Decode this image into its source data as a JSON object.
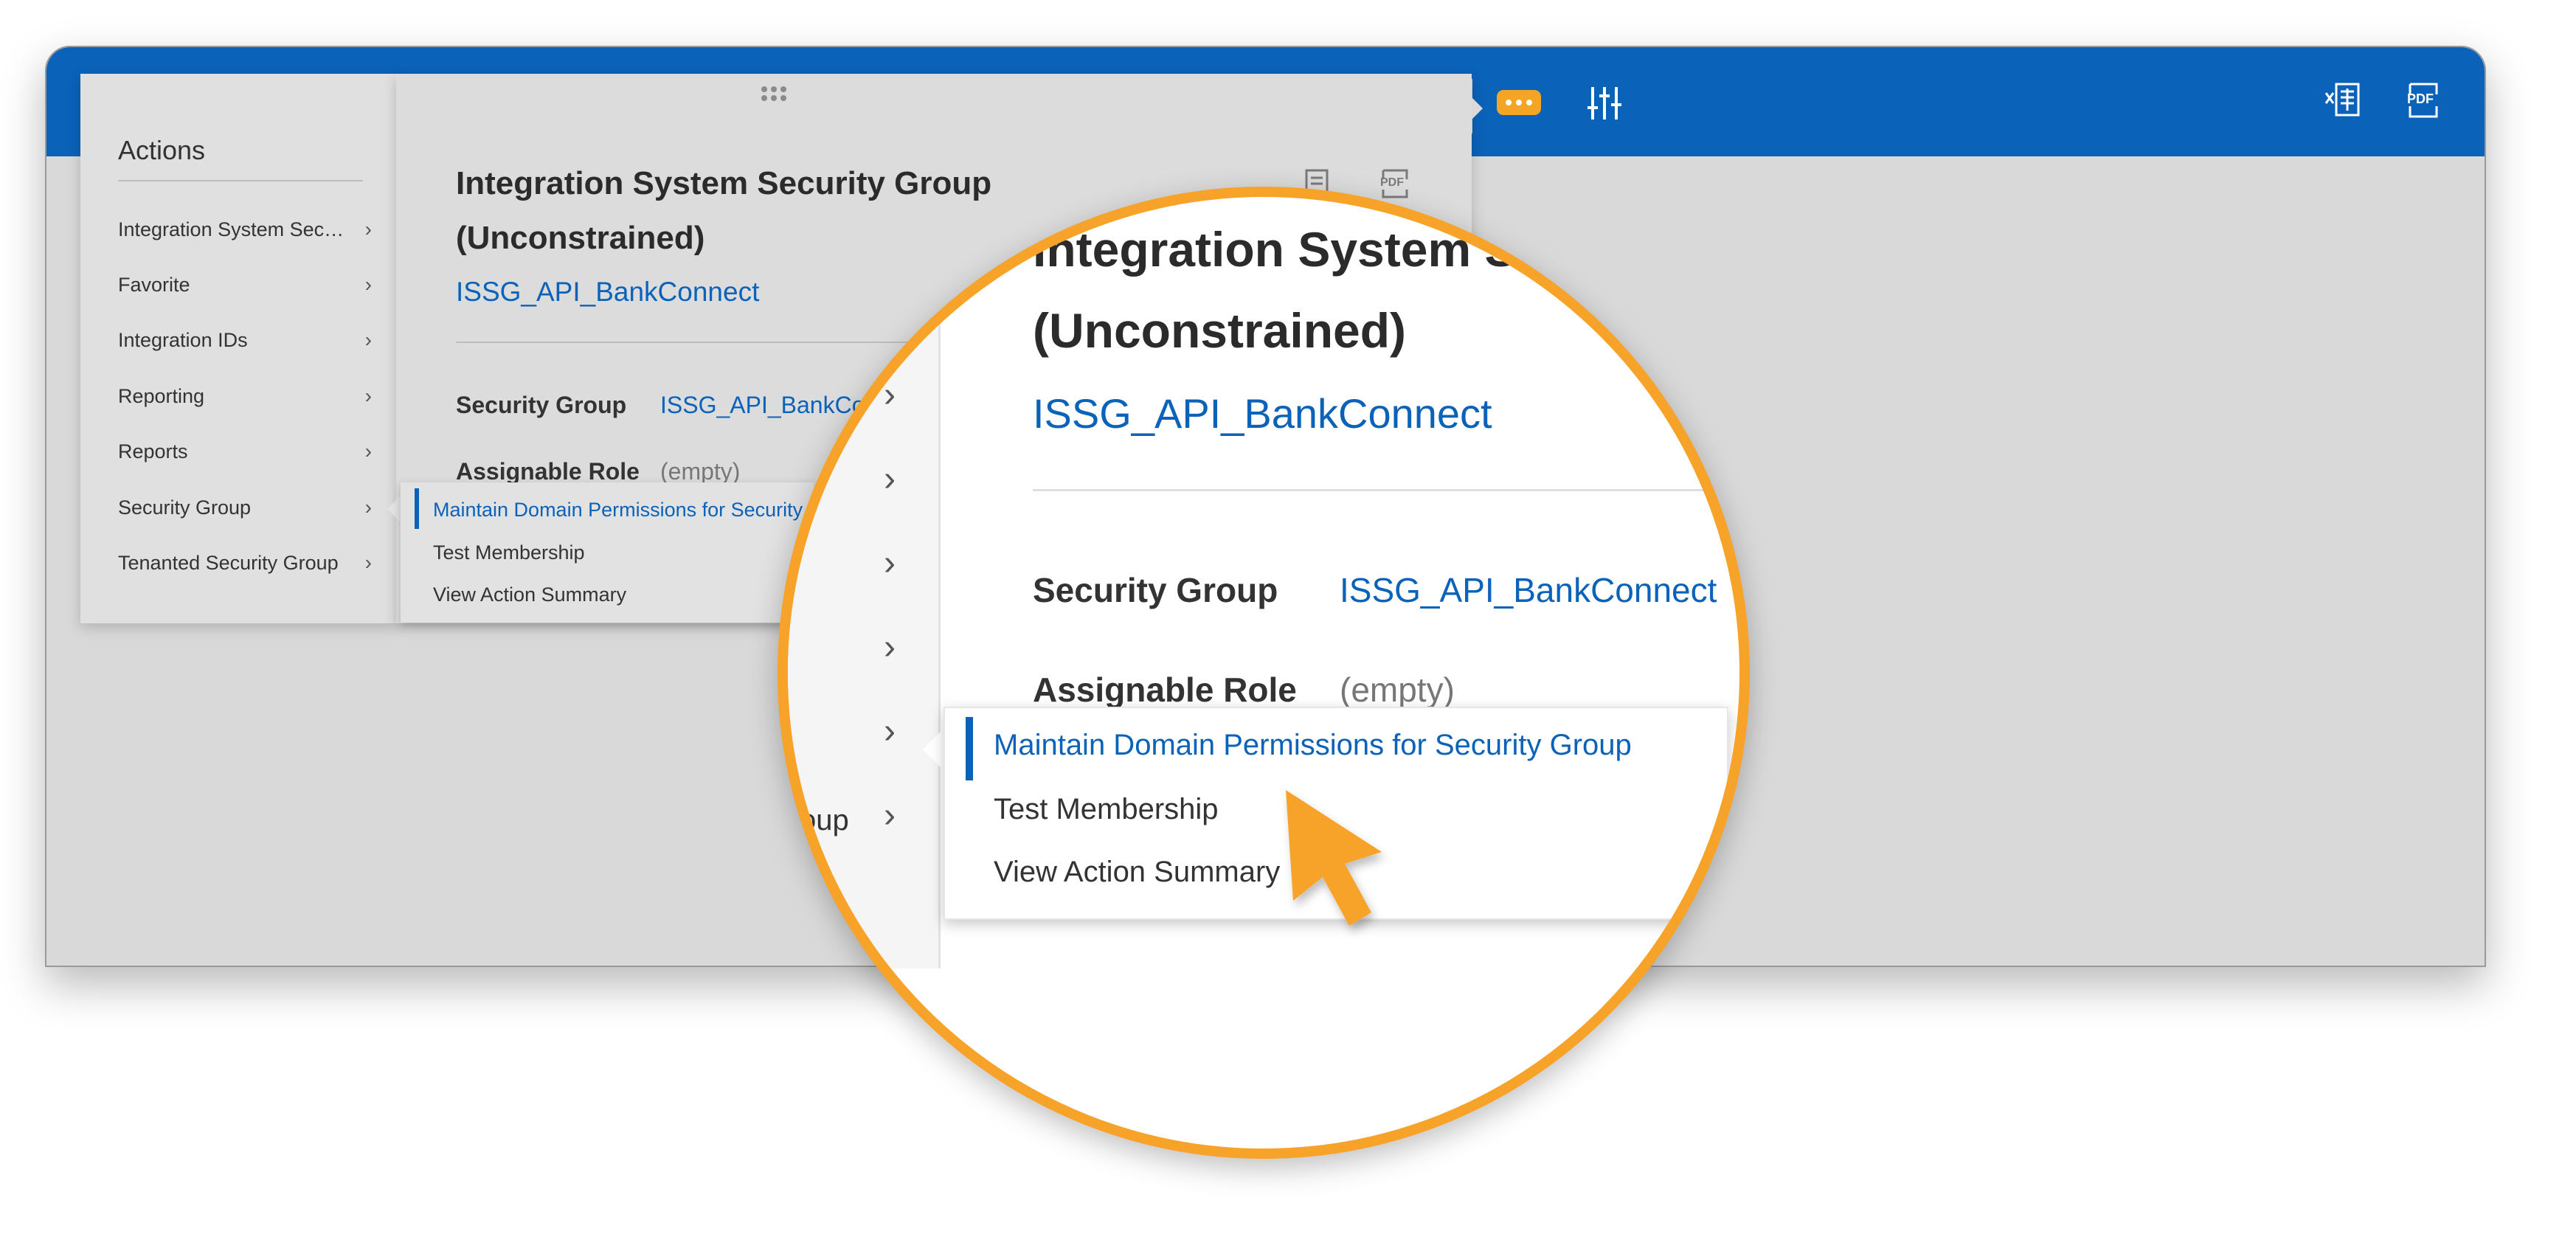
{
  "toolbar": {
    "close_icon": "close-icon",
    "more_icon": "more-options-icon",
    "filter_icon": "filter-sliders-icon",
    "excel_icon": "export-excel-icon",
    "pdf_icon": "export-pdf-icon",
    "pdf_text": "PDF"
  },
  "actions": {
    "title": "Actions",
    "items": [
      {
        "label": "Integration System Sec…"
      },
      {
        "label": "Favorite"
      },
      {
        "label": "Integration IDs"
      },
      {
        "label": "Reporting"
      },
      {
        "label": "Reports"
      },
      {
        "label": "Security Group"
      },
      {
        "label": "Tenanted Security Group"
      }
    ]
  },
  "detail": {
    "title": "Integration System Security Group (Unconstrained)",
    "subtitle_link": "ISSG_API_BankConnect",
    "fields": [
      {
        "label": "Security Group",
        "value": "ISSG_API_BankConnect"
      },
      {
        "label": "Assignable Role",
        "value": "(empty)"
      }
    ]
  },
  "submenu": {
    "items": [
      {
        "label": "Maintain Domain Permissions for Security Group",
        "active": true
      },
      {
        "label": "Test Membership"
      },
      {
        "label": "View Action Summary"
      }
    ]
  },
  "magnifier": {
    "title_line1": "Integration System Se",
    "title_line2": "(Unconstrained)",
    "left_fragment": "oup",
    "highlight_color": "#f7a32a"
  },
  "colors": {
    "brand_blue": "#0b62b9",
    "accent_orange": "#f5a524"
  }
}
